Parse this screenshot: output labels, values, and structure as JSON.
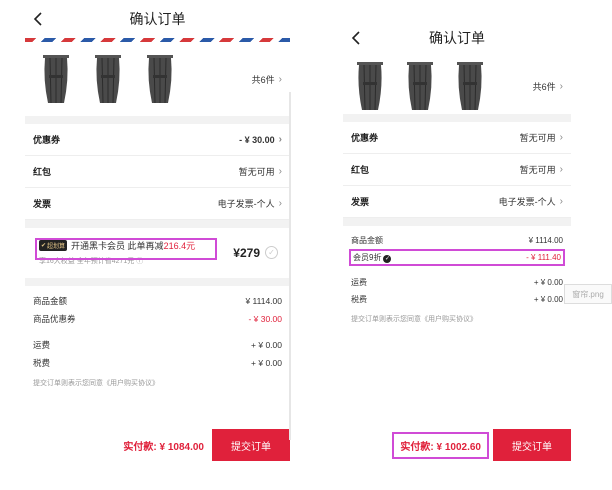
{
  "left": {
    "header": {
      "title": "确认订单"
    },
    "products": {
      "count_label": "共6件"
    },
    "rows": [
      {
        "label": "优惠券",
        "value": "- ¥ 30.00"
      },
      {
        "label": "红包",
        "value": "暂无可用"
      },
      {
        "label": "发票",
        "value": "电子发票-个人"
      }
    ],
    "member": {
      "badge": "超划算",
      "text_a": "开通黑卡会员 此单再减",
      "text_b": "216.4元",
      "sub": "享16大权益 全年预计省4271元",
      "price": "¥279"
    },
    "summary": {
      "goods_label": "商品金额",
      "goods_value": "¥ 1114.00",
      "coupon_label": "商品优惠券",
      "coupon_value": "- ¥ 30.00",
      "shipping_label": "运费",
      "shipping_value": "+ ¥ 0.00",
      "tax_label": "税费",
      "tax_value": "+ ¥ 0.00",
      "agree": "提交订单则表示您同意《用户购买协议》"
    },
    "footer": {
      "pay": "实付款: ¥ 1084.00",
      "submit": "提交订单"
    }
  },
  "right": {
    "header": {
      "title": "确认订单"
    },
    "products": {
      "count_label": "共6件"
    },
    "rows": [
      {
        "label": "优惠券",
        "value": "暂无可用"
      },
      {
        "label": "红包",
        "value": "暂无可用"
      },
      {
        "label": "发票",
        "value": "电子发票-个人"
      }
    ],
    "summary": {
      "goods_label": "商品金额",
      "goods_value": "¥ 1114.00",
      "vip_label": "会员9折",
      "vip_value": "- ¥ 111.40",
      "shipping_label": "运费",
      "shipping_value": "+ ¥ 0.00",
      "tax_label": "税费",
      "tax_value": "+ ¥ 0.00",
      "agree": "提交订单则表示您同意《用户购买协议》"
    },
    "footer": {
      "pay": "实付款: ¥ 1002.60",
      "submit": "提交订单"
    }
  },
  "watermark": "窗帘.png",
  "colors": {
    "accent": "#e0213b",
    "highlight": "#d04bd6"
  }
}
